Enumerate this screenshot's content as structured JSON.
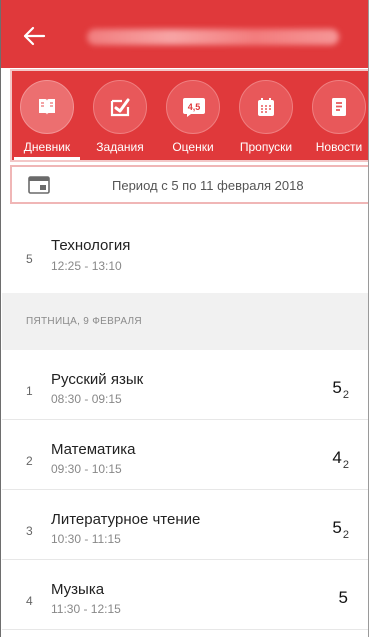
{
  "tabs": [
    {
      "label": "Дневник",
      "icon": "book-icon",
      "active": true
    },
    {
      "label": "Задания",
      "icon": "checkmark-icon",
      "active": false
    },
    {
      "label": "Оценки",
      "icon": "grades-icon",
      "icon_text": "4,5",
      "active": false
    },
    {
      "label": "Пропуски",
      "icon": "calendar-icon",
      "active": false
    },
    {
      "label": "Новости",
      "icon": "news-icon",
      "active": false
    }
  ],
  "period": {
    "label": "Период с 5 по 11 февраля 2018",
    "icon": "calendar-window-icon"
  },
  "lessons_before": [
    {
      "num": "5",
      "subject": "Технология",
      "time": "12:25 - 13:10",
      "grade": "",
      "grade_weight": ""
    }
  ],
  "day_header": "ПЯТНИЦА, 9 ФЕВРАЛЯ",
  "lessons": [
    {
      "num": "1",
      "subject": "Русский язык",
      "time": "08:30 - 09:15",
      "grade": "5",
      "grade_weight": "2"
    },
    {
      "num": "2",
      "subject": "Математика",
      "time": "09:30 - 10:15",
      "grade": "4",
      "grade_weight": "2"
    },
    {
      "num": "3",
      "subject": "Литературное чтение",
      "time": "10:30 - 11:15",
      "grade": "5",
      "grade_weight": "2"
    },
    {
      "num": "4",
      "subject": "Музыка",
      "time": "11:30 - 12:15",
      "grade": "5",
      "grade_weight": ""
    }
  ],
  "colors": {
    "accent": "#e0393b",
    "tab_circle": "#e8585a",
    "divider": "#e7e7e7",
    "day_header_bg": "#f1f1f1"
  }
}
